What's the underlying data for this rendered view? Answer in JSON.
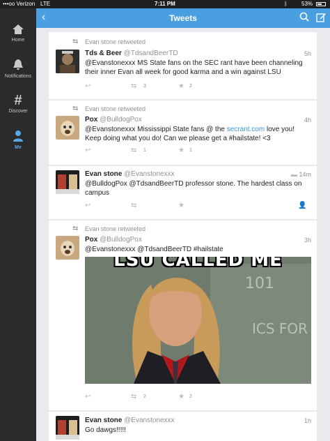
{
  "status": {
    "carrier": "•••oo Verizon",
    "network": "LTE",
    "time": "7:11 PM",
    "battery": "53%"
  },
  "sidebar": {
    "items": [
      {
        "label": "Home",
        "icon": "home-icon"
      },
      {
        "label": "Notifications",
        "icon": "bell-icon"
      },
      {
        "label": "Discover",
        "icon": "hash-icon"
      },
      {
        "label": "Me",
        "icon": "person-icon"
      }
    ]
  },
  "nav": {
    "title": "Tweets"
  },
  "tweets": [
    {
      "retweeted_by": "Evan stone retweeted",
      "name": "Tds & Beer",
      "handle": "@TdsandBeerTD",
      "time": "5h",
      "text": "@Evanstonexxx MS State fans on the SEC rant have been channeling their inner Evan all week for good karma and a win against LSU",
      "retweets": "3",
      "favorites": "2"
    },
    {
      "retweeted_by": "Evan stone retweeted",
      "name": "Pox",
      "handle": "@BulldogPox",
      "time": "4h",
      "text_before": "@Evanstonexxx Mississippi State fans @ the ",
      "link": "secrant.com",
      "text_after": " love you! Keep doing what you do! Can we please get a #hailstate! <3",
      "retweets": "1",
      "favorites": "1"
    },
    {
      "name": "Evan stone",
      "handle": "@Evanstonexxx",
      "time": "14m",
      "text": "@BulldogPox @TdsandBeerTD professor stone.  The hardest class on campus"
    },
    {
      "retweeted_by": "Evan stone retweeted",
      "name": "Pox",
      "handle": "@BulldogPox",
      "time": "3h",
      "text": "@Evanstonexxx  @TdsandBeerTD #hailstate",
      "image_caption": "LSU CALLED ME",
      "retweets": "2",
      "favorites": "2"
    },
    {
      "name": "Evan stone",
      "handle": "@Evanstonexxx",
      "time": "1h",
      "text": "Go dawgs!!!!!"
    }
  ],
  "colors": {
    "nav": "#4a9fe1",
    "sidebar": "#2a2b2d",
    "link": "#3b94d9",
    "active": "#56a8e8"
  }
}
